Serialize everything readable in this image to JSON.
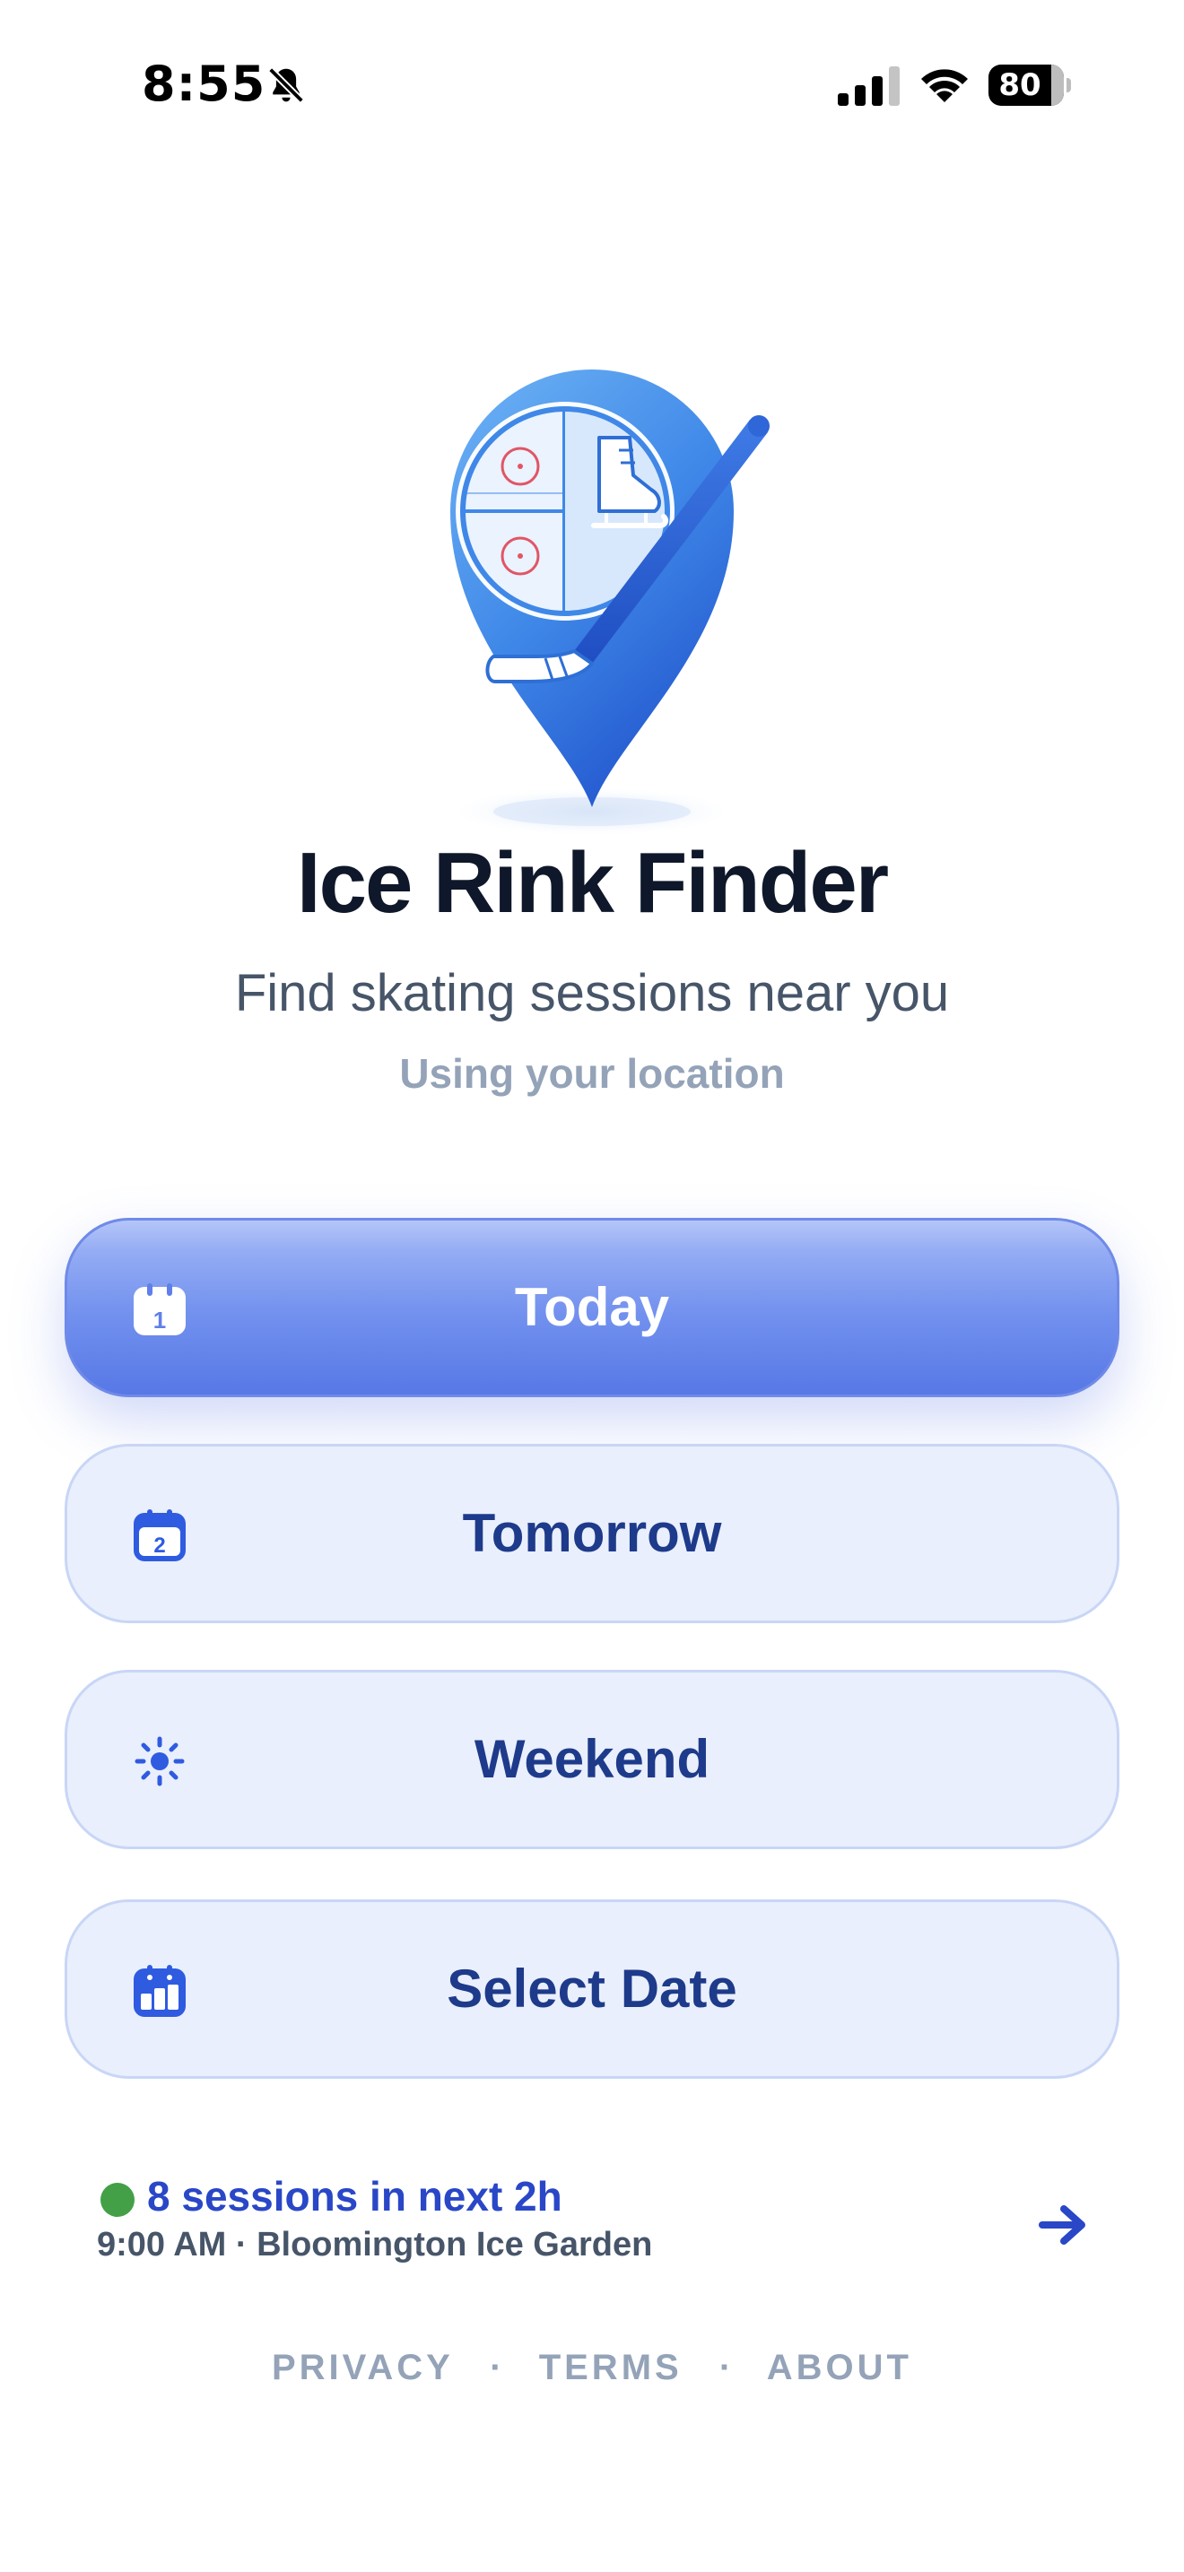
{
  "status_bar": {
    "time": "8:55",
    "battery": "80",
    "icons": [
      "bell-slash-icon",
      "cellular-signal-icon",
      "wifi-icon",
      "battery-icon"
    ]
  },
  "app": {
    "title": "Ice Rink Finder",
    "subtitle": "Find skating sessions near you",
    "location_note": "Using your location"
  },
  "options": [
    {
      "label": "Today",
      "icon": "calendar-day-1-icon",
      "selected": true
    },
    {
      "label": "Tomorrow",
      "icon": "calendar-day-2-icon",
      "selected": false
    },
    {
      "label": "Weekend",
      "icon": "sun-icon",
      "selected": false
    },
    {
      "label": "Select Date",
      "icon": "calendar-grid-icon",
      "selected": false
    }
  ],
  "sessions_banner": {
    "count_text": "8 sessions in next 2h",
    "next_session": "9:00 AM · Bloomington Ice Garden",
    "status_color": "#43a047",
    "icon": "arrow-right-icon"
  },
  "footer": {
    "links": [
      "PRIVACY",
      "TERMS",
      "ABOUT"
    ],
    "separator": "·"
  },
  "colors": {
    "primary": "#5778e6",
    "primary_text": "#1e3a8a",
    "accent_link": "#2947c7",
    "title": "#0f172a",
    "muted": "#94a3b8"
  }
}
